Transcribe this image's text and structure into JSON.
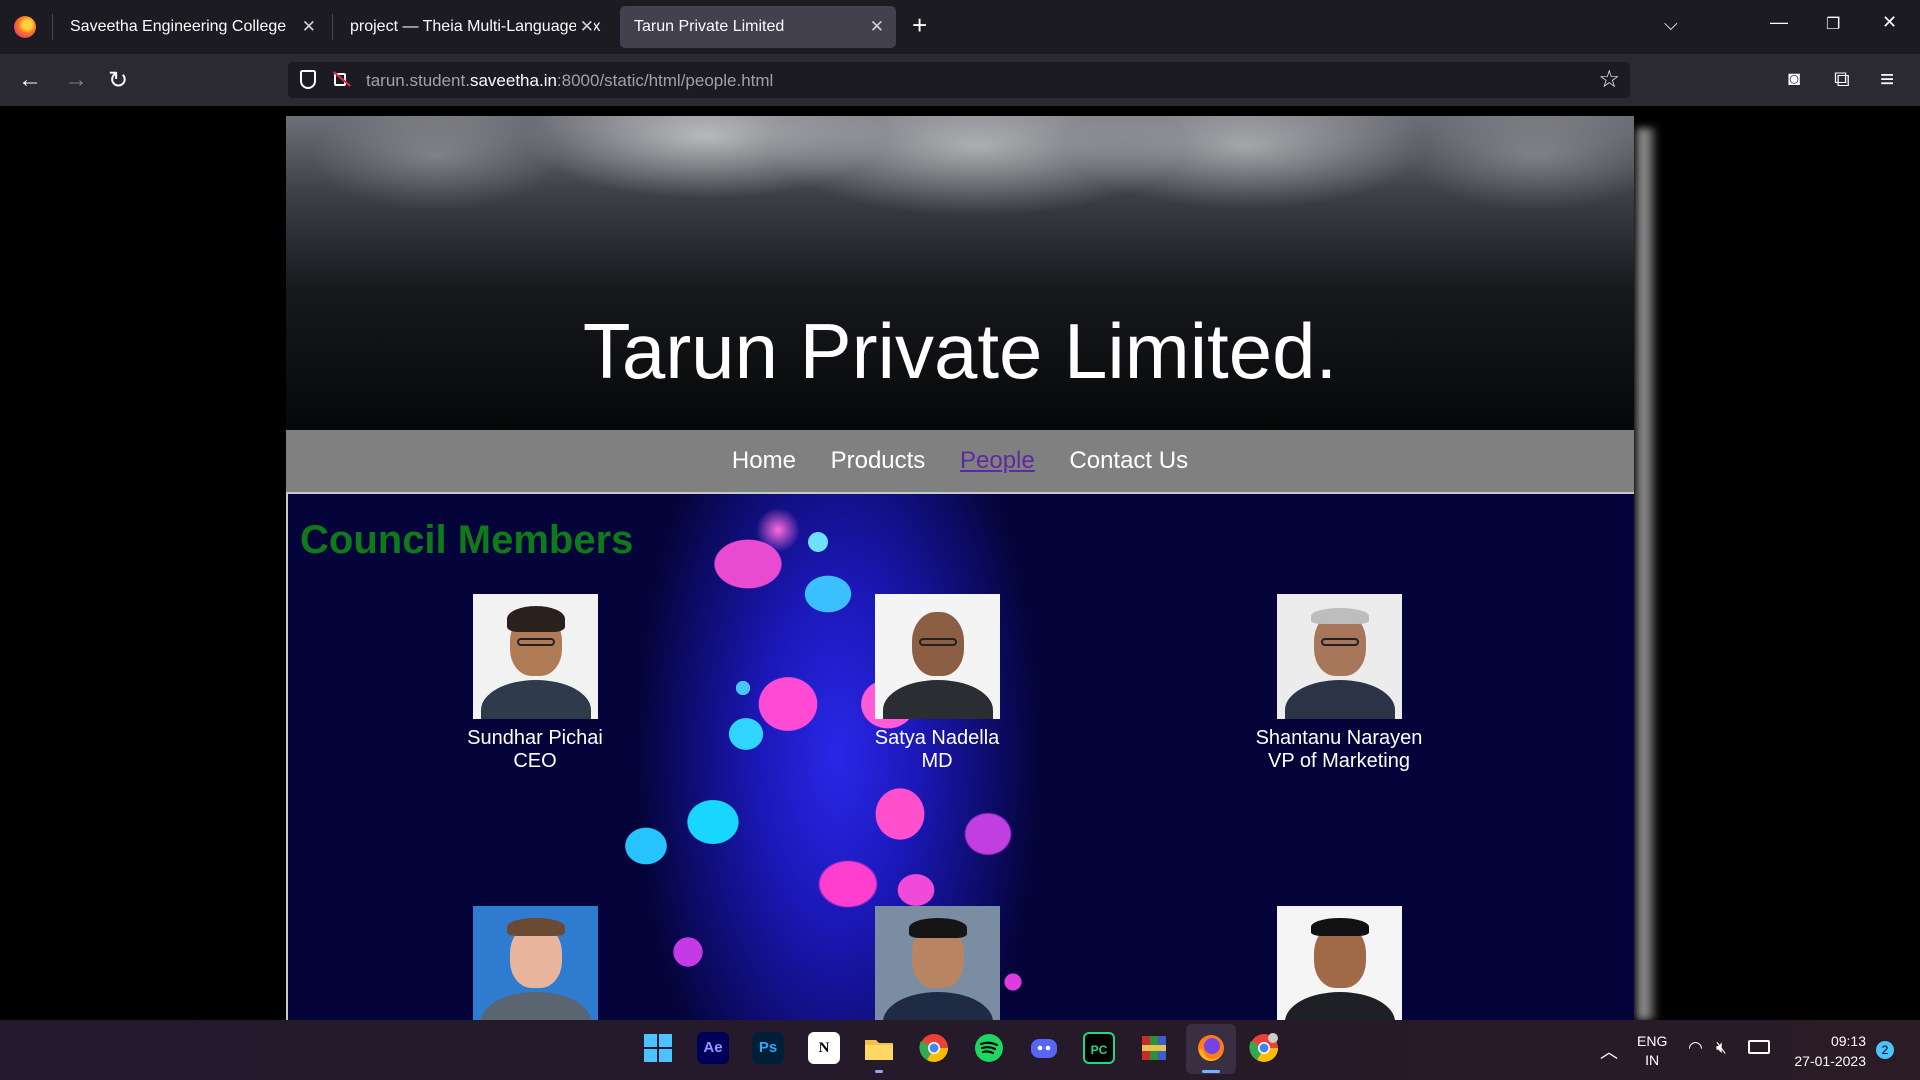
{
  "browser": {
    "tabs": [
      {
        "title": "Saveetha Engineering College"
      },
      {
        "title": "project — Theia Multi-Language Ex"
      },
      {
        "title": "Tarun Private Limited"
      }
    ],
    "url": {
      "prefix": "tarun.student.",
      "domain": "saveetha.in",
      "suffix": ":8000/static/html/people.html"
    }
  },
  "site": {
    "title": "Tarun Private Limited.",
    "nav": [
      "Home",
      "Products",
      "People",
      "Contact Us"
    ],
    "active_nav": "People",
    "section_title": "Council Members",
    "members": [
      {
        "name": "Sundhar Pichai",
        "role": "CEO"
      },
      {
        "name": "Satya Nadella",
        "role": "MD"
      },
      {
        "name": "Shantanu Narayen",
        "role": "VP of Marketing"
      },
      {
        "name": "",
        "role": ""
      },
      {
        "name": "",
        "role": ""
      },
      {
        "name": "",
        "role": ""
      }
    ]
  },
  "taskbar": {
    "apps": [
      "windows-start",
      "after-effects",
      "photoshop",
      "notion",
      "file-explorer",
      "chrome",
      "spotify",
      "discord",
      "pycharm",
      "winrar",
      "firefox",
      "chrome-alt"
    ],
    "labels": {
      "ae": "Ae",
      "ps": "Ps",
      "notion": "N",
      "pc": "PC"
    },
    "lang_top": "ENG",
    "lang_bottom": "IN",
    "time": "09:13",
    "date": "27-01-2023",
    "notifications": "2"
  },
  "colors": {
    "section_title": "#0f7a1a",
    "active_nav": "#5b2c9f",
    "menu_bg": "#808080"
  }
}
